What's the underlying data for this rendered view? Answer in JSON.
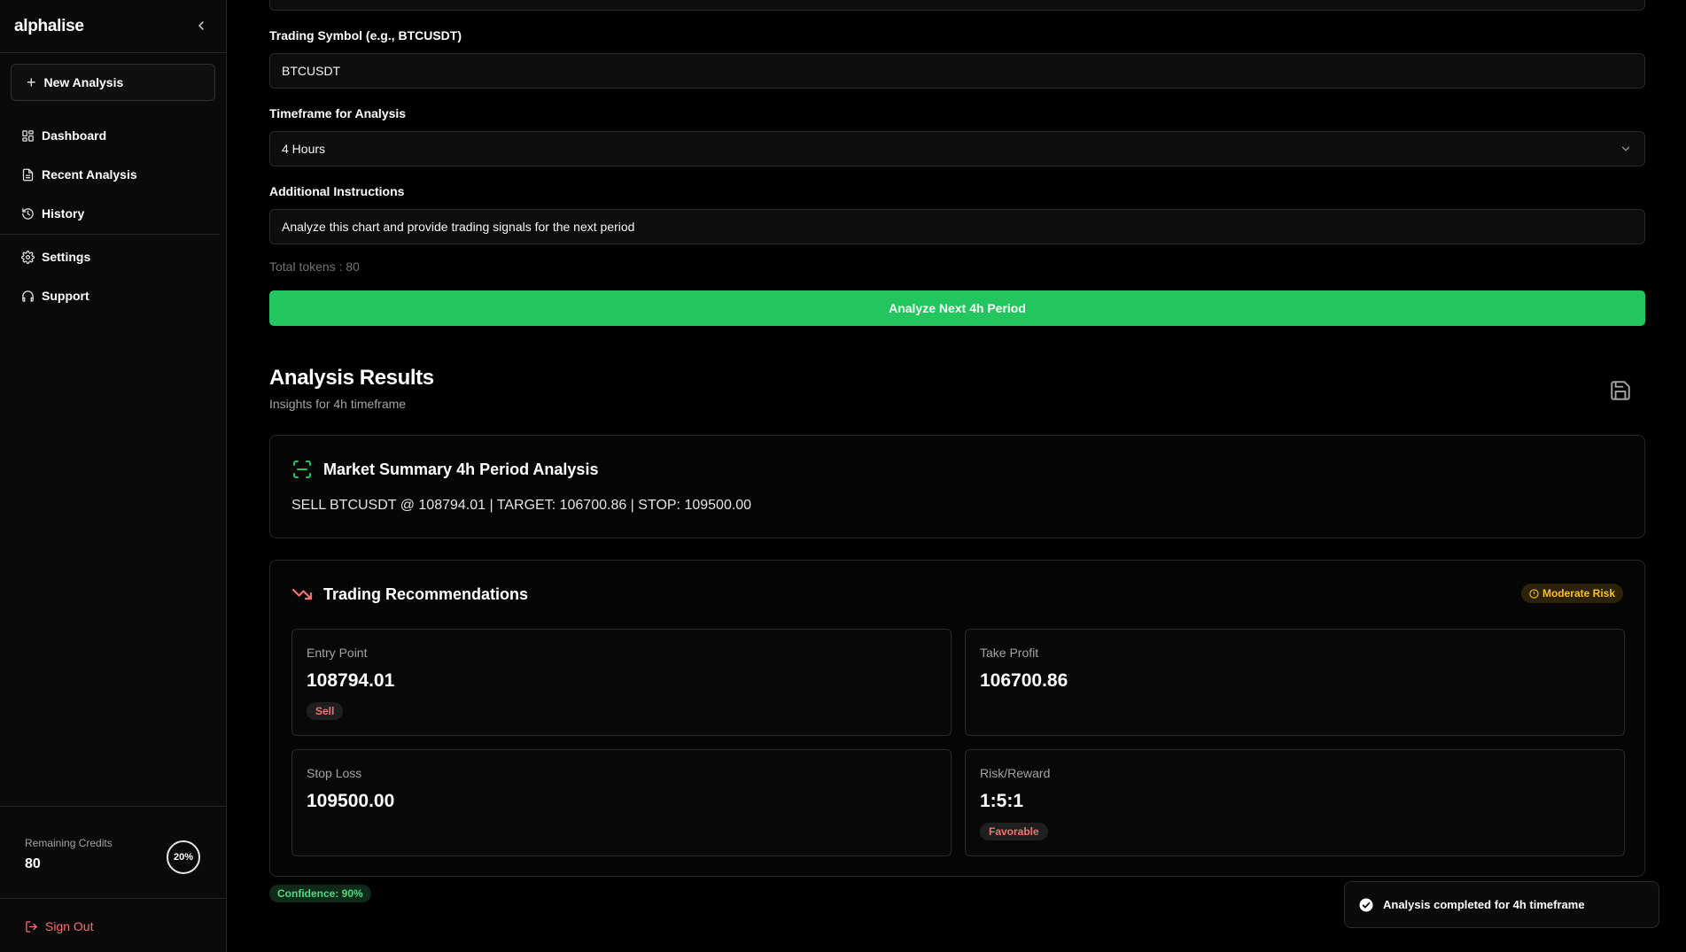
{
  "sidebar": {
    "brand": "alphalise",
    "new_analysis": "New Analysis",
    "nav": {
      "dashboard": "Dashboard",
      "recent": "Recent Analysis",
      "history": "History",
      "settings": "Settings",
      "support": "Support"
    },
    "credits": {
      "label": "Remaining Credits",
      "value": "80",
      "percent_label": "20%",
      "percent": 20
    },
    "sign_out": "Sign Out"
  },
  "form": {
    "symbol_label": "Trading Symbol (e.g., BTCUSDT)",
    "symbol_value": "BTCUSDT",
    "timeframe_label": "Timeframe for Analysis",
    "timeframe_value": "4 Hours",
    "instructions_label": "Additional Instructions",
    "instructions_value": "Analyze this chart and provide trading signals for the next period",
    "tokens": "Total tokens : 80",
    "analyze_button": "Analyze Next 4h Period"
  },
  "results": {
    "title": "Analysis Results",
    "subtitle": "Insights for 4h timeframe",
    "summary": {
      "title": "Market Summary 4h Period Analysis",
      "text": "SELL BTCUSDT @ 108794.01 | TARGET: 106700.86 | STOP: 109500.00"
    },
    "recommendations": {
      "title": "Trading Recommendations",
      "risk_badge": "Moderate Risk",
      "entry": {
        "label": "Entry Point",
        "value": "108794.01",
        "badge": "Sell"
      },
      "take_profit": {
        "label": "Take Profit",
        "value": "106700.86"
      },
      "stop_loss": {
        "label": "Stop Loss",
        "value": "109500.00"
      },
      "risk_reward": {
        "label": "Risk/Reward",
        "value": "1:5:1",
        "badge": "Favorable"
      }
    },
    "confidence": "Confidence: 90%"
  },
  "toast": {
    "message": "Analysis completed for 4h timeframe"
  },
  "colors": {
    "accent": "#22c55e",
    "danger": "#f87171",
    "warning": "#fbbf24",
    "background": "#000000"
  }
}
